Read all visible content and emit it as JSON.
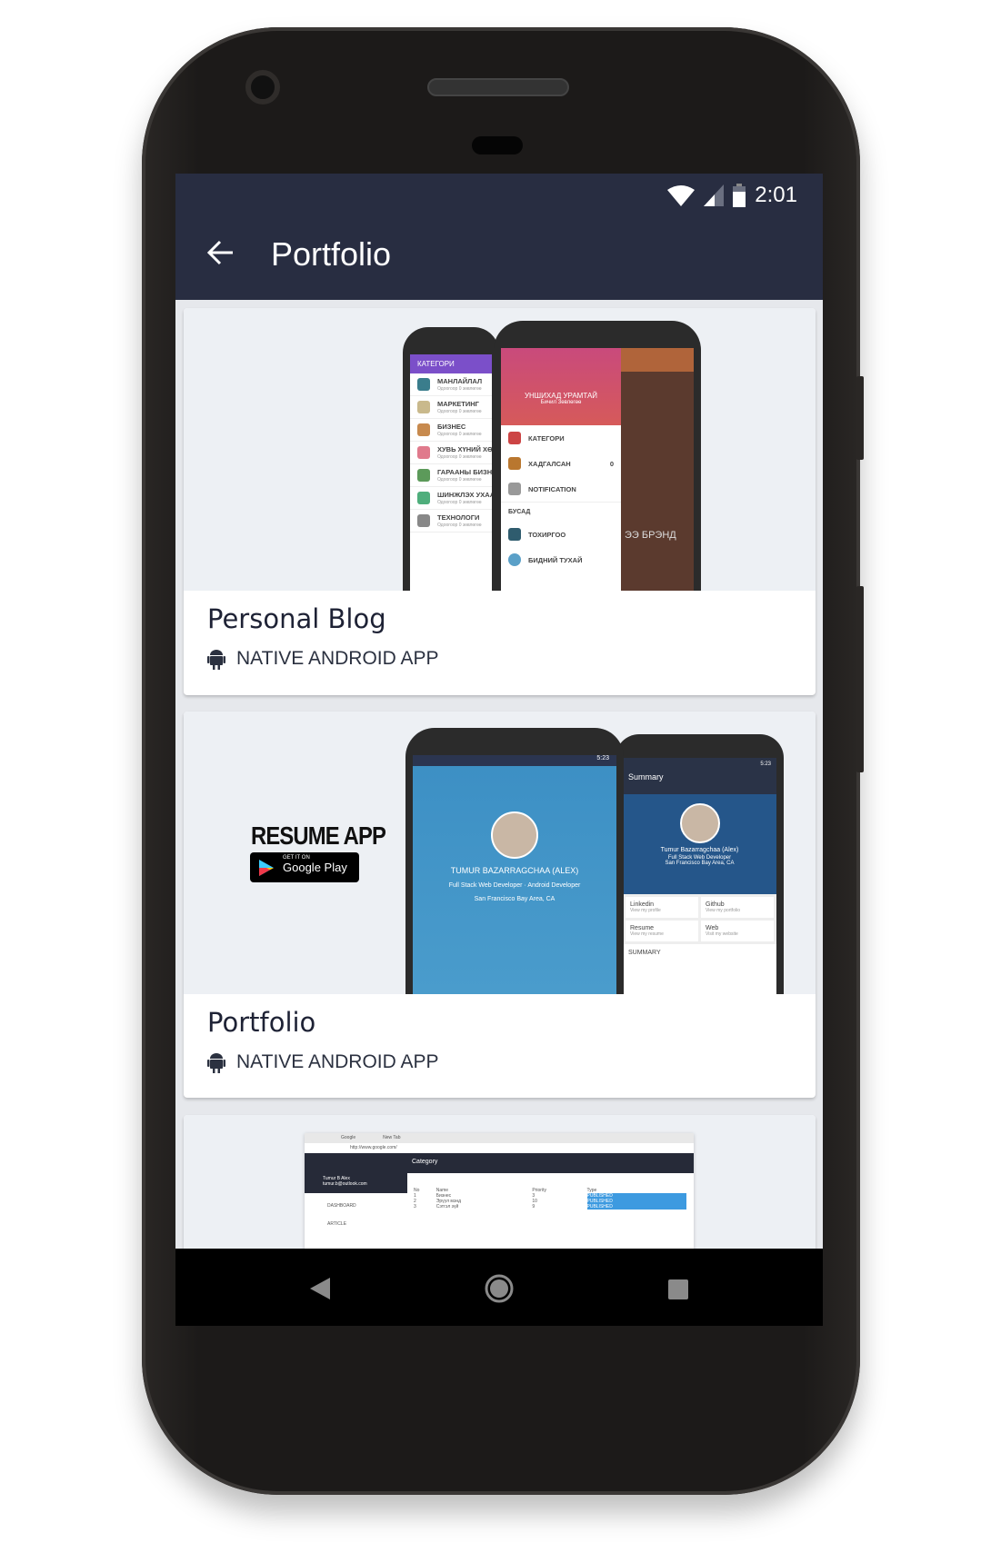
{
  "status_bar": {
    "time": "2:01"
  },
  "app_bar": {
    "title": "Portfolio",
    "back_icon": "arrow-left-icon"
  },
  "cards": [
    {
      "title": "Personal Blog",
      "subtitle": "NATIVE ANDROID APP",
      "icon": "android-icon",
      "mockup": {
        "left_header": "КАТЕГОРИ",
        "left_items": [
          "МАНЛАЙЛАЛ",
          "МАРКЕТИНГ",
          "БИЗНЕС",
          "ХУВЬ ХҮНИЙ ХӨГЖ",
          "ГАРААНЫ БИЗНЕС",
          "ШИНЖЛЭХ УХААН",
          "ТЕХНОЛОГИ"
        ],
        "left_item_sub": "Одоогоор 0 зөвлөгөө",
        "drawer_title": "УНШИХАД УРАМТАЙ",
        "drawer_subtitle": "Бичил Зөвлөгөө",
        "drawer_items": [
          "КАТЕГОРИ",
          "ХАДГАЛСАН",
          "NOTIFICATION"
        ],
        "drawer_count": "0",
        "drawer_section": "БУСАД",
        "drawer_items2": [
          "ТОХИРГОО",
          "БИДНИЙ ТУХАЙ"
        ],
        "brand_text": "ЭЭ БРЭНД"
      }
    },
    {
      "title": "Portfolio",
      "subtitle": "NATIVE ANDROID APP",
      "icon": "android-icon",
      "mockup": {
        "app_name": "RESUME APP",
        "badge_top": "GET IT ON",
        "badge_bottom": "Google Play",
        "time": "5:23",
        "name_upper": "TUMUR BAZARRAGCHAA (ALEX)",
        "name": "Tumur Bazarragchaa (Alex)",
        "role1": "Full Stack Web Developer",
        "role2": "Android Developer",
        "location": "San Francisco Bay Area, CA",
        "summary_title": "Summary",
        "tiles": [
          {
            "t": "Linkedin",
            "s": "View my profile"
          },
          {
            "t": "Github",
            "s": "View my portfolio"
          },
          {
            "t": "Resume",
            "s": "View my resume"
          },
          {
            "t": "Web",
            "s": "Visit my website"
          }
        ],
        "summary_label": "SUMMARY"
      }
    },
    {
      "mockup": {
        "tab1": "Google",
        "tab2": "New Tab",
        "url": "http://www.google.com/",
        "header": "Category",
        "user": "Tumur B Alex",
        "email": "tumur.b@outlook.com",
        "menu": [
          "DASHBOARD",
          "ARTICLE"
        ],
        "columns": [
          "No",
          "Name",
          "Priority",
          "Type"
        ],
        "rows": [
          [
            "1",
            "Бизнес",
            "3",
            "PUBLISHED"
          ],
          [
            "2",
            "Эрүүл мэнд",
            "10",
            "PUBLISHED"
          ],
          [
            "3",
            "Сэтгэл зүй",
            "9",
            "PUBLISHED"
          ]
        ]
      }
    }
  ],
  "colors": {
    "appbar": "#282d41",
    "card_bg": "#edf0f4",
    "title": "#1e2235"
  }
}
